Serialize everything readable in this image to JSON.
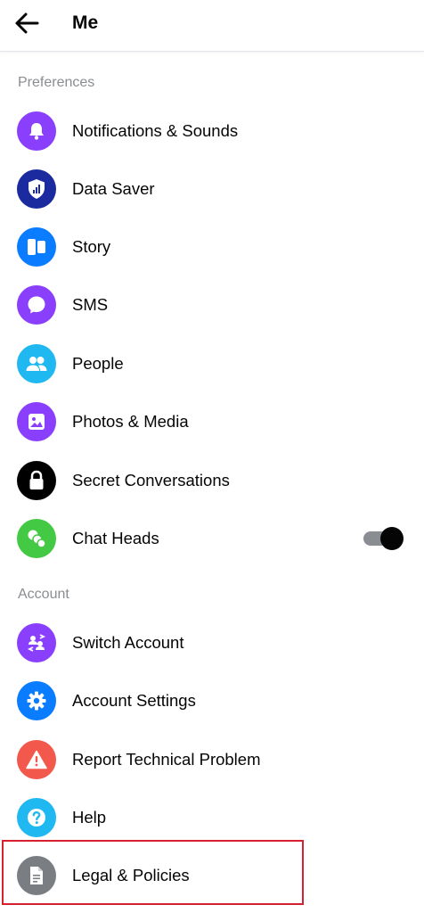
{
  "header": {
    "title": "Me",
    "back_icon": "arrow-left-icon"
  },
  "sections": {
    "preferences": "Preferences",
    "account": "Account"
  },
  "preferences": [
    {
      "label": "Notifications & Sounds",
      "icon": "bell-icon",
      "color": "#8a3ffc"
    },
    {
      "label": "Data Saver",
      "icon": "shield-signal-icon",
      "color": "#1b2a9e"
    },
    {
      "label": "Story",
      "icon": "story-icon",
      "color": "#0a7cff"
    },
    {
      "label": "SMS",
      "icon": "chat-bubble-icon",
      "color": "#8a3ffc"
    },
    {
      "label": "People",
      "icon": "people-icon",
      "color": "#1fb8f0"
    },
    {
      "label": "Photos & Media",
      "icon": "photo-icon",
      "color": "#8a3ffc"
    },
    {
      "label": "Secret Conversations",
      "icon": "lock-icon",
      "color": "#000000"
    },
    {
      "label": "Chat Heads",
      "icon": "chat-heads-icon",
      "color": "#44c944",
      "toggle": true
    }
  ],
  "account": [
    {
      "label": "Switch Account",
      "icon": "switch-account-icon",
      "color": "#8a3ffc"
    },
    {
      "label": "Account Settings",
      "icon": "gear-icon",
      "color": "#0a7cff"
    },
    {
      "label": "Report Technical Problem",
      "icon": "warning-icon",
      "color": "#f2584c"
    },
    {
      "label": "Help",
      "icon": "question-icon",
      "color": "#1fb8f0"
    },
    {
      "label": "Legal & Policies",
      "icon": "document-icon",
      "color": "#7a7d82"
    }
  ],
  "chat_heads_enabled": true
}
